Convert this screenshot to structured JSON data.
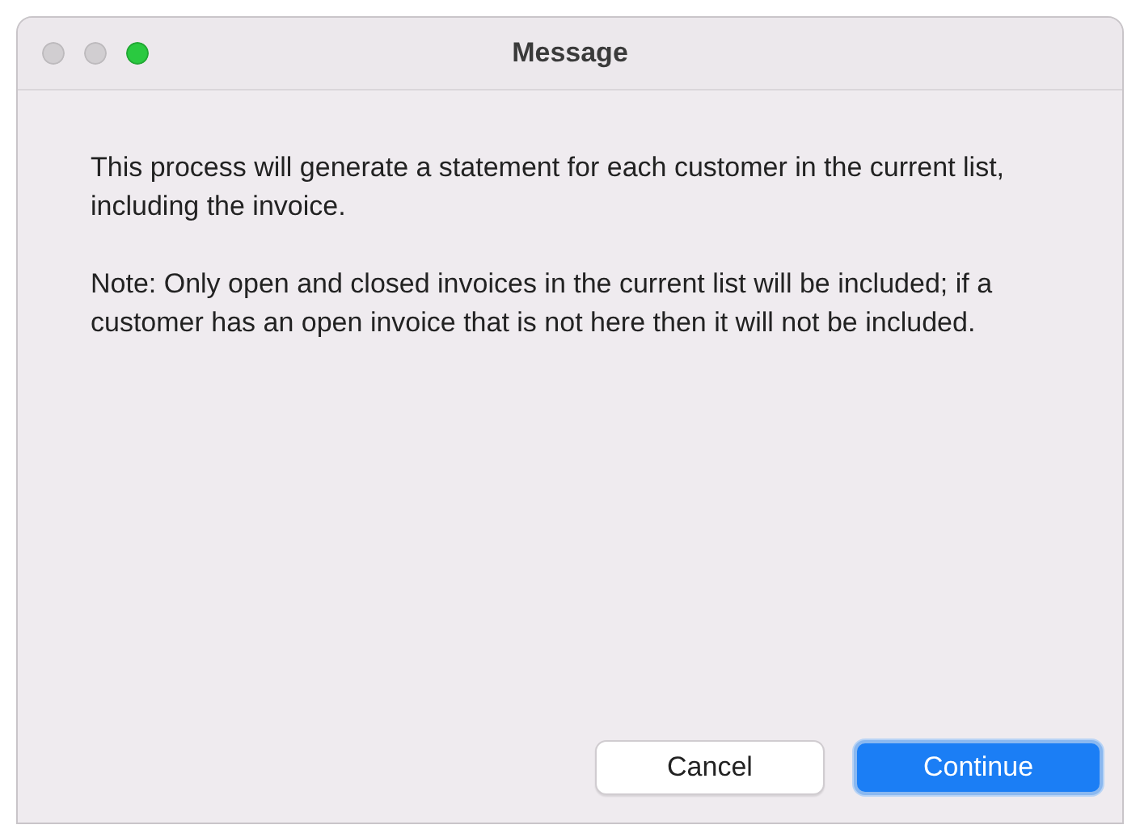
{
  "window": {
    "title": "Message"
  },
  "paragraphs": [
    "This process will generate a statement for each customer in the current list, including the invoice.",
    "Note: Only open and closed invoices in the current list will be included; if a customer has an open invoice that is not here then it will not be included."
  ],
  "buttons": [
    {
      "label": "Cancel",
      "kind": "normal"
    },
    {
      "label": "Continue",
      "kind": "default"
    }
  ]
}
